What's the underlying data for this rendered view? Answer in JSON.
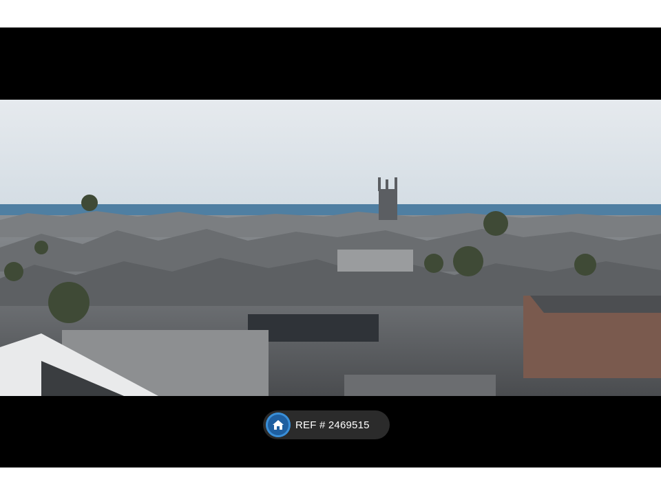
{
  "listing": {
    "ref_prefix": "REF #",
    "ref_number": "2469515"
  },
  "colors": {
    "letterbox": "#000000",
    "page_background": "#ffffff",
    "sky": "#dfe5ea",
    "sea": "#4f7fa2",
    "badge_background": "#2b2b2b",
    "home_icon_accent": "#1f5fa0"
  },
  "icons": {
    "ref_icon": "home-icon"
  }
}
